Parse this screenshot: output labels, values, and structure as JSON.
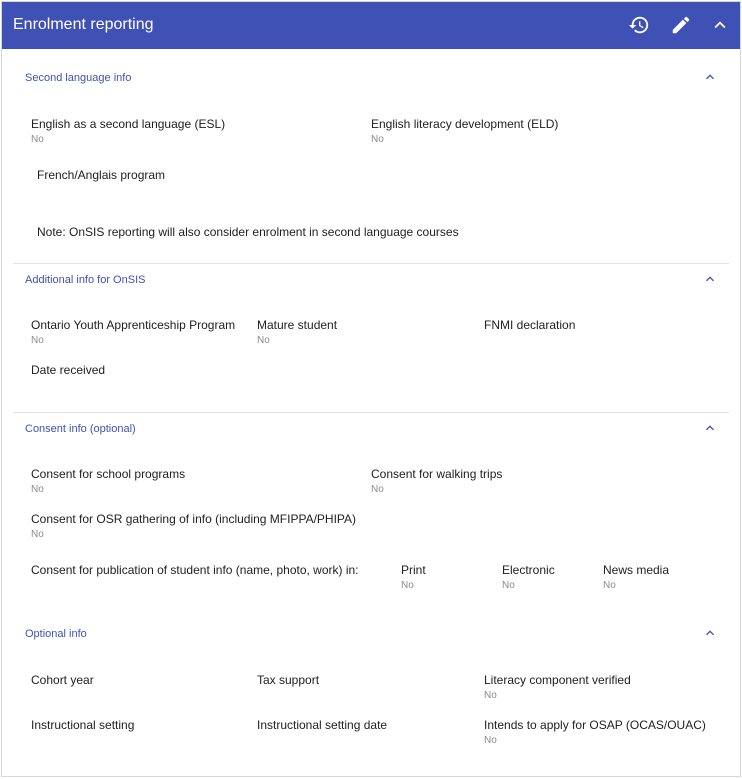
{
  "header": {
    "title": "Enrolment reporting",
    "icons": [
      "history-icon",
      "edit-icon",
      "chevron-up-icon"
    ],
    "color": "#3f51b5"
  },
  "sections": {
    "second_language": {
      "title": "Second language info",
      "esl": {
        "label": "English as a second language (ESL)",
        "value": "No"
      },
      "eld": {
        "label": "English literacy development (ELD)",
        "value": "No"
      },
      "french_anglais": {
        "label": "French/Anglais program"
      },
      "note": "Note: OnSIS reporting will also consider enrolment in second language courses"
    },
    "additional": {
      "title": "Additional info for OnSIS",
      "oyap": {
        "label": "Ontario Youth Apprenticeship Program",
        "value": "No"
      },
      "mature": {
        "label": "Mature student",
        "value": "No"
      },
      "fnmi": {
        "label": "FNMI declaration"
      },
      "date_received": {
        "label": "Date received"
      }
    },
    "consent": {
      "title": "Consent info (optional)",
      "school_programs": {
        "label": "Consent for school programs",
        "value": "No"
      },
      "walking_trips": {
        "label": "Consent for walking trips",
        "value": "No"
      },
      "osr": {
        "label": "Consent for OSR gathering of info (including MFIPPA/PHIPA)",
        "value": "No"
      },
      "publication": {
        "label": "Consent for publication of student info (name, photo, work) in:"
      },
      "print": {
        "label": "Print",
        "value": "No"
      },
      "electronic": {
        "label": "Electronic",
        "value": "No"
      },
      "news_media": {
        "label": "News media",
        "value": "No"
      }
    },
    "optional": {
      "title": "Optional info",
      "cohort_year": {
        "label": "Cohort year"
      },
      "tax_support": {
        "label": "Tax support"
      },
      "literacy": {
        "label": "Literacy component verified",
        "value": "No"
      },
      "instructional_setting": {
        "label": "Instructional setting"
      },
      "instructional_setting_date": {
        "label": "Instructional setting date"
      },
      "osap": {
        "label": "Intends to apply for OSAP (OCAS/OUAC)",
        "value": "No"
      }
    }
  }
}
